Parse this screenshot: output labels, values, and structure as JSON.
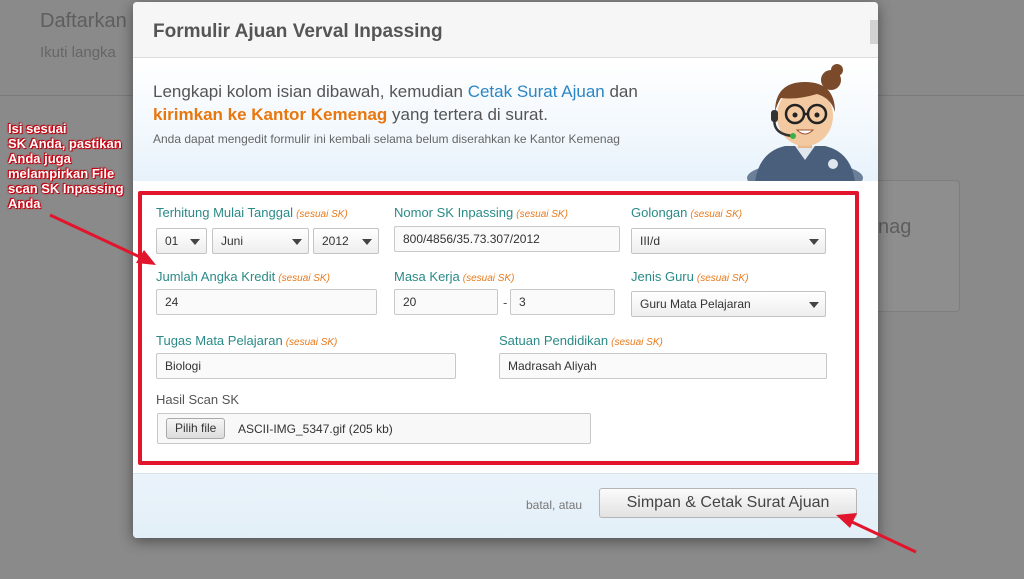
{
  "background": {
    "title_partial": "Daftarkan",
    "subtitle_partial": "Ikuti langka",
    "card_text_partial": "nag"
  },
  "modal": {
    "title": "Formulir Ajuan Verval Inpassing",
    "intro": {
      "line1_prefix": "Lengkapi kolom isian dibawah, kemudian ",
      "line1_link": "Cetak Surat Ajuan",
      "line1_suffix": " dan",
      "line2_highlight": "kirimkan ke Kantor Kemenag",
      "line2_suffix": " yang tertera di surat.",
      "note": "Anda dapat mengedit formulir ini kembali selama belum diserahkan ke Kantor Kemenag"
    },
    "form": {
      "hint": "(sesuai SK)",
      "tanggal": {
        "label": "Terhitung Mulai Tanggal",
        "day": "01",
        "month": "Juni",
        "year": "2012"
      },
      "nomor_sk": {
        "label": "Nomor SK Inpassing",
        "value": "800/4856/35.73.307/2012"
      },
      "golongan": {
        "label": "Golongan",
        "value": "III/d"
      },
      "angka_kredit": {
        "label": "Jumlah Angka Kredit",
        "value": "24"
      },
      "masa_kerja": {
        "label": "Masa Kerja",
        "years": "20",
        "separator": "-",
        "months": "3"
      },
      "jenis_guru": {
        "label": "Jenis Guru",
        "value": "Guru Mata Pelajaran"
      },
      "tugas_mapel": {
        "label": "Tugas Mata Pelajaran",
        "value": "Biologi"
      },
      "satuan_pendidikan": {
        "label": "Satuan Pendidikan",
        "value": "Madrasah Aliyah"
      },
      "hasil_scan": {
        "label": "Hasil Scan SK",
        "button": "Pilih file",
        "filename": "ASCII-IMG_5347.gif (205 kb)"
      }
    },
    "footer": {
      "cancel": "batal, atau",
      "submit": "Simpan & Cetak Surat Ajuan"
    }
  },
  "annotation": {
    "callout_lines": [
      "Isi sesuai",
      "SK Anda, pastikan",
      "Anda juga",
      "melampirkan File",
      "scan SK Inpassing",
      "Anda"
    ],
    "color": "#e1152b"
  }
}
